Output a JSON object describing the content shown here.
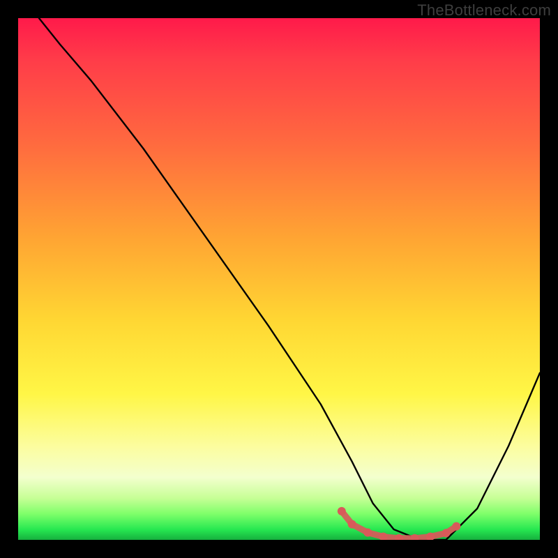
{
  "watermark": {
    "text": "TheBottleneck.com"
  },
  "chart_data": {
    "type": "line",
    "title": "",
    "xlabel": "",
    "ylabel": "",
    "xlim": [
      0,
      100
    ],
    "ylim": [
      0,
      100
    ],
    "grid": false,
    "series": [
      {
        "name": "bottleneck-curve",
        "x": [
          4,
          8,
          14,
          24,
          36,
          48,
          58,
          64,
          68,
          72,
          77,
          82,
          88,
          94,
          100
        ],
        "y": [
          100,
          95,
          88,
          75,
          58,
          41,
          26,
          15,
          7,
          2,
          0,
          0,
          6,
          18,
          32
        ]
      }
    ],
    "annotations": [
      {
        "name": "trough-marker",
        "type": "dotted-segment",
        "color": "#d85a5a",
        "points_x": [
          62,
          64,
          67,
          70,
          73,
          76,
          79,
          82,
          84
        ],
        "points_y": [
          5.5,
          3.0,
          1.4,
          0.6,
          0.3,
          0.3,
          0.6,
          1.3,
          2.6
        ]
      }
    ]
  }
}
